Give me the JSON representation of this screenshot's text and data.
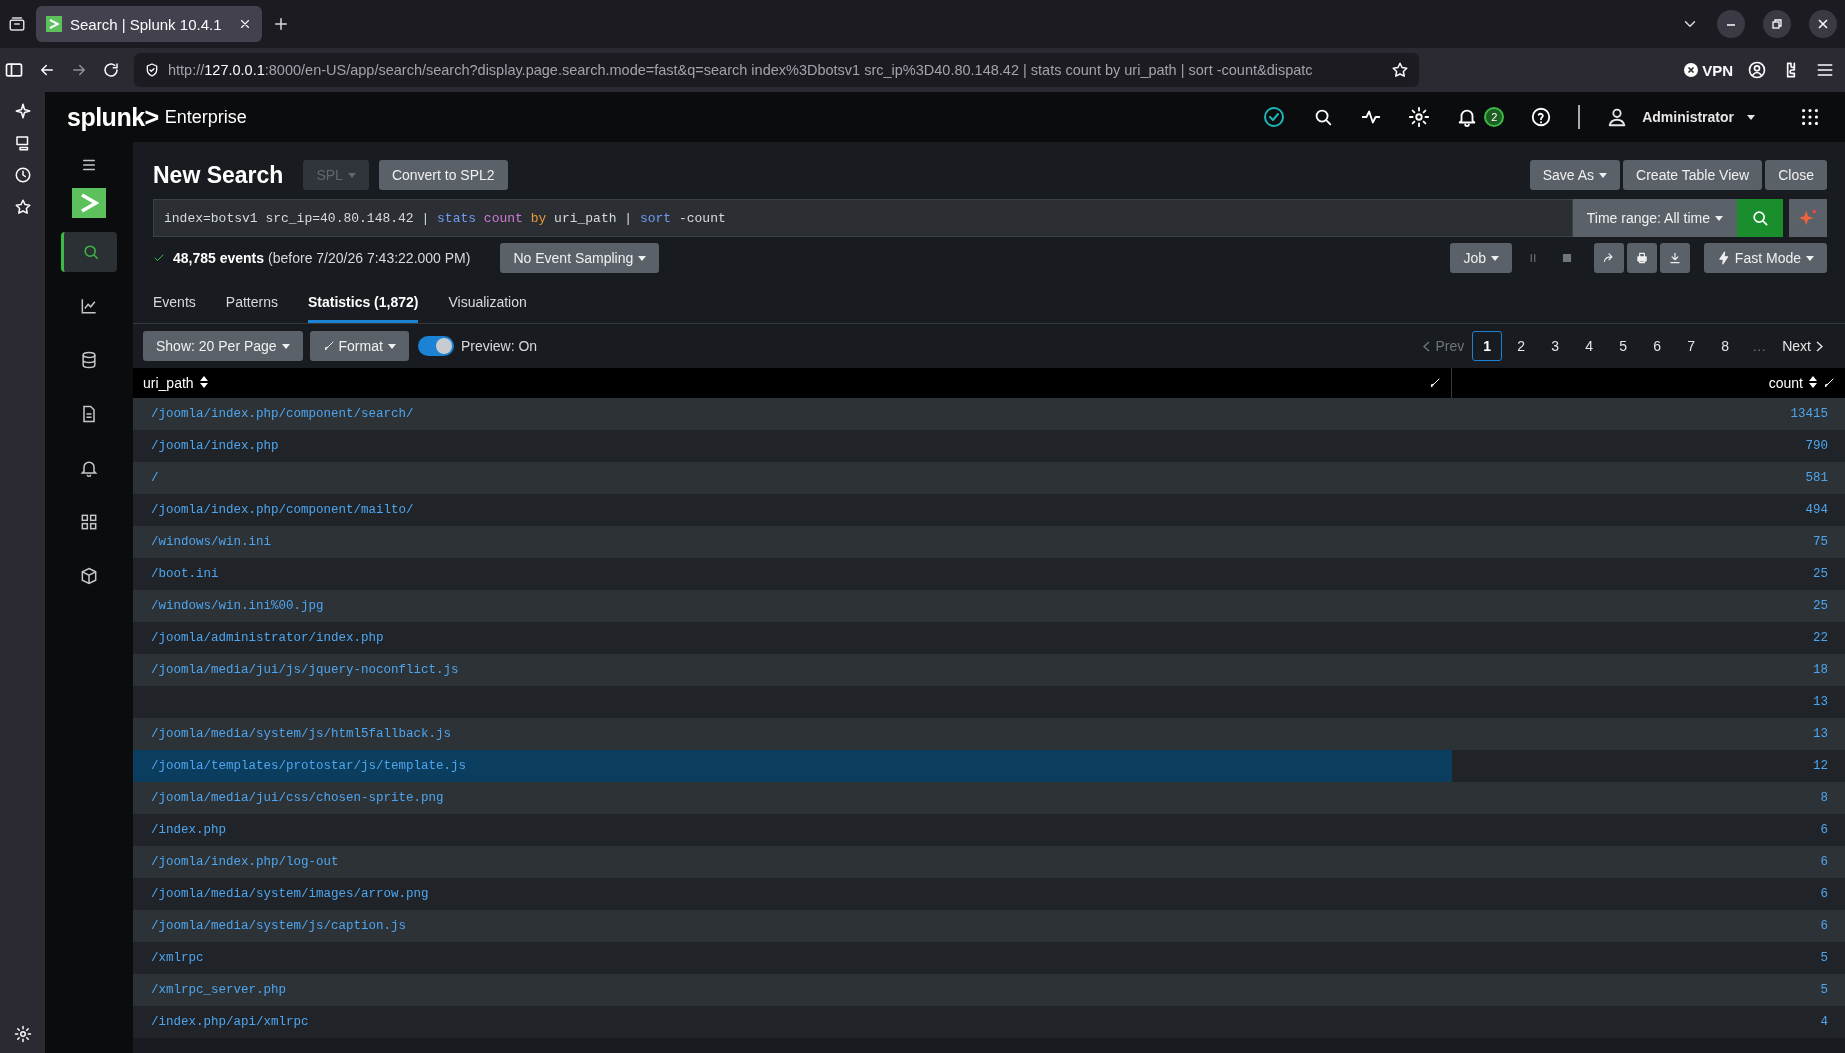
{
  "browser": {
    "tab_title": "Search | Splunk 10.4.1",
    "url": {
      "scheme": "http://",
      "host": "127.0.0.1",
      "path": ":8000/en-US/app/search/search?display.page.search.mode=fast&q=search index%3Dbotsv1 src_ip%3D40.80.148.42 | stats count by uri_path | sort -count&dispatc"
    },
    "vpn": "VPN"
  },
  "header": {
    "logo": "splunk>",
    "product": "Enterprise",
    "notifications": "2",
    "user": "Administrator"
  },
  "nav": [
    {
      "selected": true
    },
    {
      "selected": false
    },
    {
      "selected": false
    },
    {
      "selected": false
    },
    {
      "selected": false
    },
    {
      "selected": false
    },
    {
      "selected": false
    }
  ],
  "search": {
    "title": "New Search",
    "language": {
      "label": "SPL",
      "disabled": true
    },
    "convert": "Convert to SPL2",
    "actions": [
      "Save As",
      "Create Table View",
      "Close"
    ],
    "query": [
      {
        "kind": "text",
        "text": "index=botsv1 src_ip=40.80.148.42 | "
      },
      {
        "kind": "command",
        "text": "stats"
      },
      {
        "kind": "function",
        "text": " count"
      },
      {
        "kind": "keyword",
        "text": " by"
      },
      {
        "kind": "text",
        "text": " uri_path | "
      },
      {
        "kind": "command",
        "text": "sort"
      },
      {
        "kind": "text",
        "text": " -count"
      }
    ],
    "time_range": "Time range: All time",
    "events": "48,785 events",
    "events_note": "(before 7/20/26 7:43:22.000 PM)",
    "sampling": "No Event Sampling",
    "job": "Job",
    "mode": "Fast Mode"
  },
  "tabs": [
    {
      "label": "Events",
      "selected": false
    },
    {
      "label": "Patterns",
      "selected": false
    },
    {
      "label": "Statistics (1,872)",
      "selected": true
    },
    {
      "label": "Visualization",
      "selected": false
    }
  ],
  "toolbar": {
    "show": "Show: 20 Per Page",
    "format": "Format",
    "preview": {
      "on": true,
      "label": "Preview: On"
    }
  },
  "pagination": {
    "prev": {
      "label": "Prev",
      "disabled": true
    },
    "pages": [
      {
        "label": "1",
        "selected": true
      },
      {
        "label": "2",
        "selected": false
      },
      {
        "label": "3",
        "selected": false
      },
      {
        "label": "4",
        "selected": false
      },
      {
        "label": "5",
        "selected": false
      },
      {
        "label": "6",
        "selected": false
      },
      {
        "label": "7",
        "selected": false
      },
      {
        "label": "8",
        "selected": false
      }
    ],
    "ellipsis": "…",
    "next": "Next"
  },
  "table": {
    "columns": [
      "uri_path",
      "count"
    ],
    "rows": [
      {
        "uri_path": "/joomla/index.php/component/search/",
        "count": "13415",
        "selected": false
      },
      {
        "uri_path": "/joomla/index.php",
        "count": "790",
        "selected": false
      },
      {
        "uri_path": "/",
        "count": "581",
        "selected": false
      },
      {
        "uri_path": "/joomla/index.php/component/mailto/",
        "count": "494",
        "selected": false
      },
      {
        "uri_path": "/windows/win.ini",
        "count": "75",
        "selected": false
      },
      {
        "uri_path": "/boot.ini",
        "count": "25",
        "selected": false
      },
      {
        "uri_path": "/windows/win.ini%00.jpg",
        "count": "25",
        "selected": false
      },
      {
        "uri_path": "/joomla/administrator/index.php",
        "count": "22",
        "selected": false
      },
      {
        "uri_path": "/joomla/media/jui/js/jquery-noconflict.js",
        "count": "18",
        "selected": false
      },
      {
        "count": "13",
        "selected": false
      },
      {
        "uri_path": "/joomla/media/system/js/html5fallback.js",
        "count": "13",
        "selected": false
      },
      {
        "uri_path": "/joomla/templates/protostar/js/template.js",
        "count": "12",
        "selected": true
      },
      {
        "uri_path": "/joomla/media/jui/css/chosen-sprite.png",
        "count": "8",
        "selected": false
      },
      {
        "uri_path": "/index.php",
        "count": "6",
        "selected": false
      },
      {
        "uri_path": "/joomla/index.php/log-out",
        "count": "6",
        "selected": false
      },
      {
        "uri_path": "/joomla/media/system/images/arrow.png",
        "count": "6",
        "selected": false
      },
      {
        "uri_path": "/joomla/media/system/js/caption.js",
        "count": "6",
        "selected": false
      },
      {
        "uri_path": "/xmlrpc",
        "count": "5",
        "selected": false
      },
      {
        "uri_path": "/xmlrpc_server.php",
        "count": "5",
        "selected": false
      },
      {
        "uri_path": "/index.php/api/xmlrpc",
        "count": "4",
        "selected": false
      }
    ]
  }
}
